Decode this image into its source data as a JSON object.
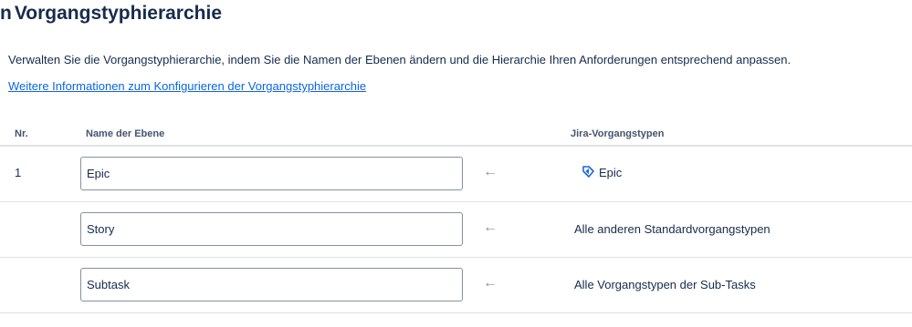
{
  "page": {
    "title_prefix": "n",
    "title": "Vorgangstyphierarchie",
    "description": "Verwalten Sie die Vorgangstyphierarchie, indem Sie die Namen der Ebenen ändern und die Hierarchie Ihren Anforderungen entsprechend anpassen.",
    "more_link": "Weitere Informationen zum Konfigurieren der Vorgangstyphierarchie"
  },
  "table": {
    "headers": {
      "nr": "Nr.",
      "level_name": "Name der Ebene",
      "jira_types": "Jira-Vorgangstypen"
    },
    "rows": [
      {
        "nr": "1",
        "level_name": "Epic",
        "arrow": "←",
        "jira_type": "Epic",
        "icon": "epic-icon"
      },
      {
        "nr": "",
        "level_name": "Story",
        "arrow": "←",
        "jira_type": "Alle anderen Standardvorgangstypen"
      },
      {
        "nr": "",
        "level_name": "Subtask",
        "arrow": "←",
        "jira_type": "Alle Vorgangstypen der Sub-Tasks"
      }
    ]
  },
  "colors": {
    "link": "#0c66e4",
    "text": "#172b4d",
    "epic_icon": "#1868db",
    "border": "#dfe1e6"
  }
}
